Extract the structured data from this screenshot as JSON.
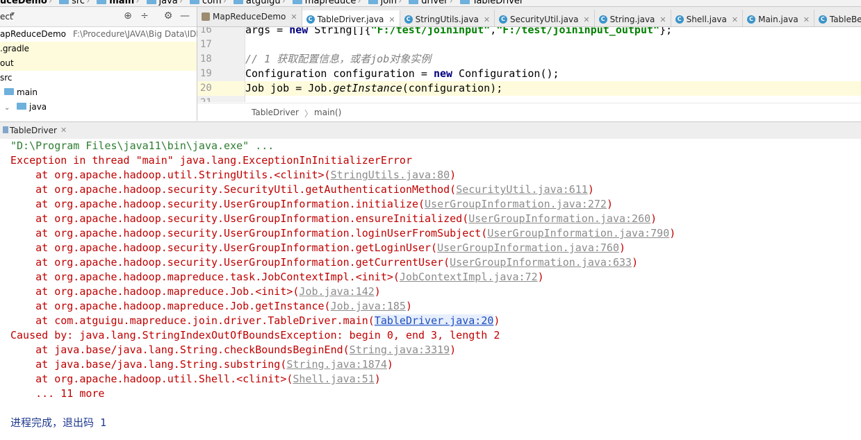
{
  "breadcrumb": [
    "uceDemo",
    "src",
    "main",
    "java",
    "com",
    "atguigu",
    "mapreduce",
    "join",
    "driver",
    "TableDriver"
  ],
  "project_panel": {
    "title": "ect",
    "tree": [
      {
        "label": "apReduceDemo",
        "path": "F:\\Procedure\\JAVA\\Big Data\\IDEA",
        "indent": 0
      },
      {
        "label": ".gradle",
        "indent": 0,
        "highlight": true
      },
      {
        "label": "out",
        "indent": 0,
        "highlight": true
      },
      {
        "label": "src",
        "indent": 0
      },
      {
        "label": "main",
        "indent": 1
      },
      {
        "label": "java",
        "indent": 1
      }
    ]
  },
  "tabs": [
    {
      "label": "MapReduceDemo",
      "icon": "module-icon"
    },
    {
      "label": "TableDriver.java",
      "icon": "class-icon",
      "active": true
    },
    {
      "label": "StringUtils.java",
      "icon": "class-icon"
    },
    {
      "label": "SecurityUtil.java",
      "icon": "class-icon"
    },
    {
      "label": "String.java",
      "icon": "class-icon"
    },
    {
      "label": "Shell.java",
      "icon": "class-icon"
    },
    {
      "label": "Main.java",
      "icon": "class-icon"
    },
    {
      "label": "TableBea",
      "icon": "class-icon"
    }
  ],
  "editor": {
    "line_numbers": [
      "16",
      "17",
      "18",
      "19",
      "20",
      "21"
    ],
    "current_line": "20",
    "line16": "args = ",
    "line16_kw": "new",
    "line16_b": " String[]{",
    "line16_s1": "\"F:/test/joininput\"",
    "line16_c": ",",
    "line16_s2": "\"F:/test/joininput_output\"",
    "line16_e": "};",
    "line18_comment": "// 1 获取配置信息，或者job对象实例",
    "line19_a": "Configuration configuration = ",
    "line19_kw": "new",
    "line19_b": " Configuration();",
    "line20_a": "Job job = Job.",
    "line20_it": "getInstance",
    "line20_b": "(configuration);",
    "crumb_class": "TableDriver",
    "crumb_method": "main()"
  },
  "run": {
    "tab_label": "TableDriver",
    "command": "\"D:\\Program Files\\java11\\bin\\java.exe\" ...",
    "exception": "Exception in thread \"main\" java.lang.ExceptionInInitializerError",
    "frames": [
      {
        "text": "    at org.apache.hadoop.util.StringUtils.<clinit>(",
        "link": "StringUtils.java:80"
      },
      {
        "text": "    at org.apache.hadoop.security.SecurityUtil.getAuthenticationMethod(",
        "link": "SecurityUtil.java:611"
      },
      {
        "text": "    at org.apache.hadoop.security.UserGroupInformation.initialize(",
        "link": "UserGroupInformation.java:272"
      },
      {
        "text": "    at org.apache.hadoop.security.UserGroupInformation.ensureInitialized(",
        "link": "UserGroupInformation.java:260"
      },
      {
        "text": "    at org.apache.hadoop.security.UserGroupInformation.loginUserFromSubject(",
        "link": "UserGroupInformation.java:790"
      },
      {
        "text": "    at org.apache.hadoop.security.UserGroupInformation.getLoginUser(",
        "link": "UserGroupInformation.java:760"
      },
      {
        "text": "    at org.apache.hadoop.security.UserGroupInformation.getCurrentUser(",
        "link": "UserGroupInformation.java:633"
      },
      {
        "text": "    at org.apache.hadoop.mapreduce.task.JobContextImpl.<init>(",
        "link": "JobContextImpl.java:72"
      },
      {
        "text": "    at org.apache.hadoop.mapreduce.Job.<init>(",
        "link": "Job.java:142"
      },
      {
        "text": "    at org.apache.hadoop.mapreduce.Job.getInstance(",
        "link": "Job.java:185"
      },
      {
        "text": "    at com.atguigu.mapreduce.join.driver.TableDriver.main(",
        "link": "TableDriver.java:20",
        "active": true
      }
    ],
    "caused_by": "Caused by: java.lang.StringIndexOutOfBoundsException: begin 0, end 3, length 2",
    "cause_frames": [
      {
        "text": "    at java.base/java.lang.String.checkBoundsBeginEnd(",
        "link": "String.java:3319"
      },
      {
        "text": "    at java.base/java.lang.String.substring(",
        "link": "String.java:1874"
      },
      {
        "text": "    at org.apache.hadoop.util.Shell.<clinit>(",
        "link": "Shell.java:51"
      }
    ],
    "more": "    ... 11 more",
    "exit": "进程完成，退出码 1"
  }
}
